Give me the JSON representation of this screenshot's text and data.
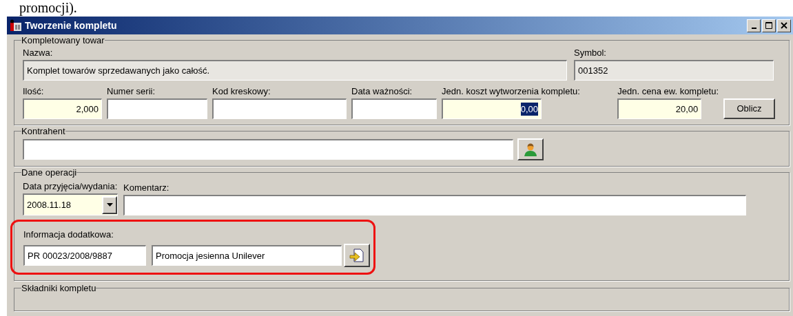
{
  "document_text": "promocji).",
  "window": {
    "title": "Tworzenie kompletu"
  },
  "product": {
    "legend": "Kompletowany towar",
    "name": {
      "label": "Nazwa:",
      "value": "Komplet towarów sprzedawanych jako całość.",
      "readonly": true
    },
    "symbol": {
      "label": "Symbol:",
      "value": "001352",
      "readonly": true
    },
    "fields": [
      {
        "label": "Ilość:",
        "value": "2,000",
        "required": true,
        "selected": false
      },
      {
        "label": "Numer serii:",
        "required": false
      },
      {
        "label": "Kod kreskowy:",
        "required": false
      },
      {
        "label": "Data ważności:",
        "required": false
      },
      {
        "label": "Jedn. koszt wytworzenia kompletu:",
        "value": "0,00",
        "required": true,
        "selected": true
      },
      {
        "label": "Jedn. cena ew. kompletu:",
        "value": "20,00",
        "required": true,
        "selected": false
      }
    ],
    "calc_button": "Oblicz"
  },
  "contractor": {
    "legend": "Kontrahent"
  },
  "operation": {
    "legend": "Dane operacji",
    "date": {
      "label": "Data przyjęcia/wydania:",
      "value": "2008.11.18",
      "required": true
    },
    "comment": {
      "label": "Komentarz:"
    },
    "extra": {
      "label": "Informacja dodatkowa:",
      "code": "PR 00023/2008/9887",
      "description": "Promocja jesienna Unilever",
      "highlighted": true
    }
  },
  "components": {
    "legend": "Składniki kompletu"
  }
}
